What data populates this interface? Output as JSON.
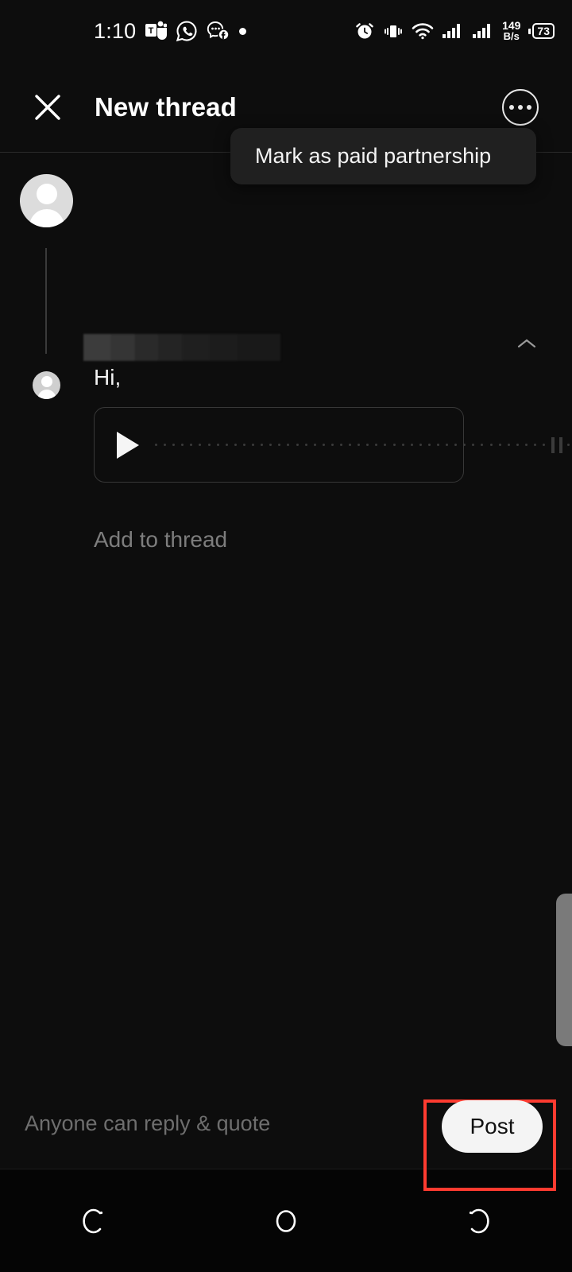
{
  "status_bar": {
    "time": "1:10",
    "left_icons": [
      "teams-icon",
      "whatsapp-icon",
      "messenger-icon",
      "dot-indicator-icon"
    ],
    "right_icons": [
      "alarm-icon",
      "vibrate-icon",
      "wifi-icon",
      "signal-sim1-icon",
      "signal-sim2-icon"
    ],
    "network_speed_value": "149",
    "network_speed_unit": "B/s",
    "battery_level": "73"
  },
  "header": {
    "close_label": "close-icon",
    "title": "New thread",
    "more_label": "more-options-icon"
  },
  "dropdown": {
    "items": [
      {
        "label": "Mark as paid partnership"
      }
    ]
  },
  "composer": {
    "username_redacted": "",
    "post_text": "Hi,",
    "audio": {
      "play_label": "play-icon",
      "waveform_dots": 48
    },
    "add_to_thread_placeholder": "Add to thread",
    "collapse_label": "chevron-up-icon"
  },
  "footer": {
    "reply_setting": "Anyone can reply & quote",
    "post_label": "Post",
    "highlight_color": "#ff3b30"
  },
  "nav_bar": {
    "recents_label": "recents-icon",
    "home_label": "home-icon",
    "back_label": "back-icon"
  },
  "theme": {
    "background": "#0d0d0d",
    "surface": "#202020",
    "text_primary": "#f2f2f2",
    "text_secondary": "#6e6e6e",
    "accent": "#f4f4f4"
  }
}
